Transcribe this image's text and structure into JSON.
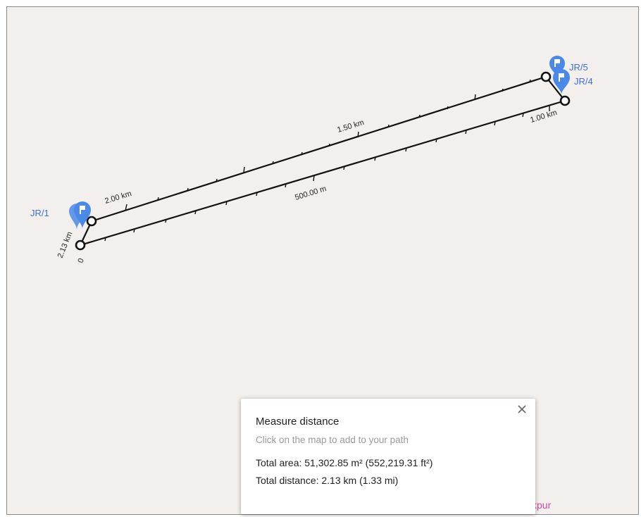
{
  "markers": [
    {
      "label": "JR/1"
    },
    {
      "label": "JR/5"
    },
    {
      "label": "JR/4"
    }
  ],
  "distance_labels": [
    "2.00 km",
    "1.50 km",
    "500.00 m",
    "1.00 km",
    "2.13 km",
    "0"
  ],
  "panel": {
    "title": "Measure distance",
    "hint": "Click on the map to add to your path",
    "area_line": "Total area: 51,302.85 m² (552,219.31 ft²)",
    "distance_line": "Total distance: 2.13 km (1.33 mi)",
    "close_icon": "close-icon"
  },
  "map": {
    "place_label": "kpur",
    "colors": {
      "background": "#f2efec",
      "marker": "#4a89e8",
      "path": "#111111",
      "place": "#c94ca3"
    }
  }
}
